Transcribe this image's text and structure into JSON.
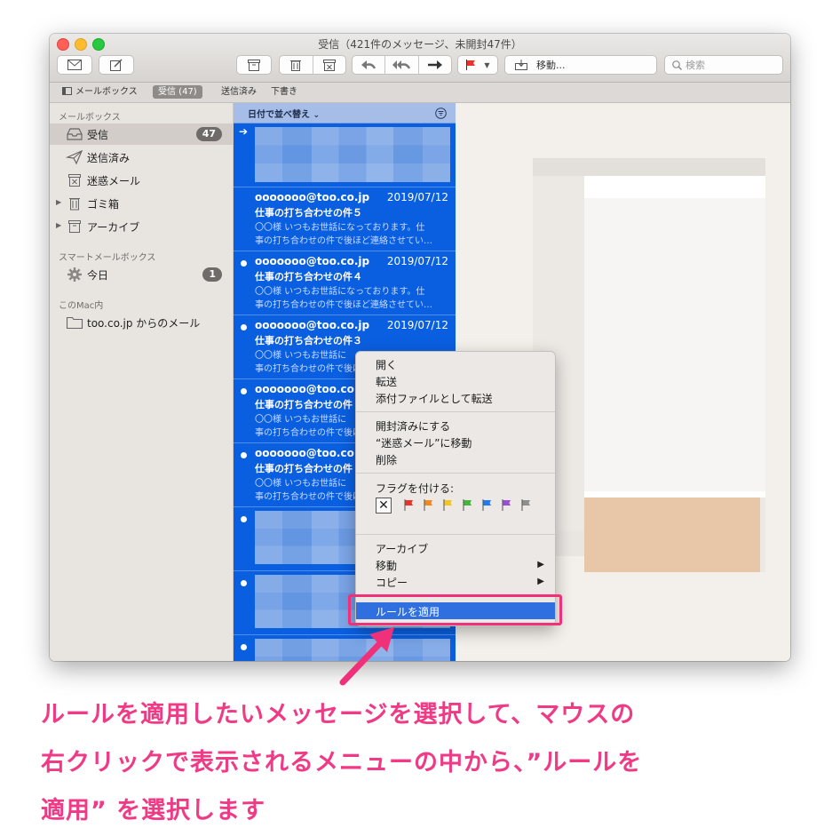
{
  "window": {
    "title": "受信（421件のメッセージ、未開封47件）"
  },
  "toolbar": {
    "icons": [
      "envelope-icon",
      "compose-icon",
      "archive-icon",
      "trash-icon",
      "junk-icon",
      "reply-icon",
      "reply-all-icon",
      "forward-icon",
      "flag-icon"
    ],
    "move_label": "移動...",
    "search_placeholder": "検索"
  },
  "tabbar": {
    "mailbox_label": "メールボックス",
    "inbox_label": "受信 (47)",
    "sent_label": "送信済み",
    "drafts_label": "下書き"
  },
  "sidebar": {
    "section_mailboxes": "メールボックス",
    "items": [
      {
        "label": "受信",
        "badge": "47"
      },
      {
        "label": "送信済み"
      },
      {
        "label": "迷惑メール"
      },
      {
        "label": "ゴミ箱"
      },
      {
        "label": "アーカイブ"
      }
    ],
    "section_smart": "スマートメールボックス",
    "smart_items": [
      {
        "label": "今日",
        "badge": "1"
      }
    ],
    "section_mac": "このMac内",
    "mac_items": [
      {
        "label": "too.co.jp からのメール"
      }
    ]
  },
  "message_list": {
    "sort_label": "日付で並べ替え",
    "messages": [
      {
        "from": "ooooooo@too.co.jp",
        "date": "2019/07/12",
        "subject": "仕事の打ち合わせの件５",
        "preview1": "〇〇様 いつもお世話になっております。仕",
        "preview2": "事の打ち合わせの件で後ほど連絡させてい…"
      },
      {
        "from": "ooooooo@too.co.jp",
        "date": "2019/07/12",
        "subject": "仕事の打ち合わせの件４",
        "preview1": "〇〇様 いつもお世話になっております。仕",
        "preview2": "事の打ち合わせの件で後ほど連絡させてい…"
      },
      {
        "from": "ooooooo@too.co.jp",
        "date": "2019/07/12",
        "subject": "仕事の打ち合わせの件３",
        "preview1": "〇〇様 いつもお世話に",
        "preview2": "事の打ち合わせの件で後ほど"
      },
      {
        "from": "ooooooo@too.co.jp",
        "subject": "仕事の打ち合わせの件",
        "preview1": "〇〇様 いつもお世話に",
        "preview2": "事の打ち合わせの件で後ほど"
      },
      {
        "from": "ooooooo@too.co.jp",
        "subject": "仕事の打ち合わせの件",
        "preview1": "〇〇様 いつもお世話に",
        "preview2": "事の打ち合わせの件で後ほど"
      }
    ]
  },
  "context_menu": {
    "open": "開く",
    "forward": "転送",
    "forward_attachment": "添付ファイルとして転送",
    "mark_read": "開封済みにする",
    "move_to_junk": "“迷惑メール”に移動",
    "delete": "削除",
    "flag_label": "フラグを付ける:",
    "flag_colors": [
      "#e8322a",
      "#f08a1c",
      "#f5c51e",
      "#43b53b",
      "#1e7bf0",
      "#9b4dd6",
      "#8e8e8e"
    ],
    "archive": "アーカイブ",
    "move": "移動",
    "copy": "コピー",
    "apply_rules": "ルールを適用"
  },
  "annotation": {
    "line1": "ルールを適用したいメッセージを選択して、マウスの",
    "line2": "右クリックで表示されるメニューの中から、”ルールを",
    "line3": "適用” を選択します",
    "color": "#ef3a85"
  }
}
